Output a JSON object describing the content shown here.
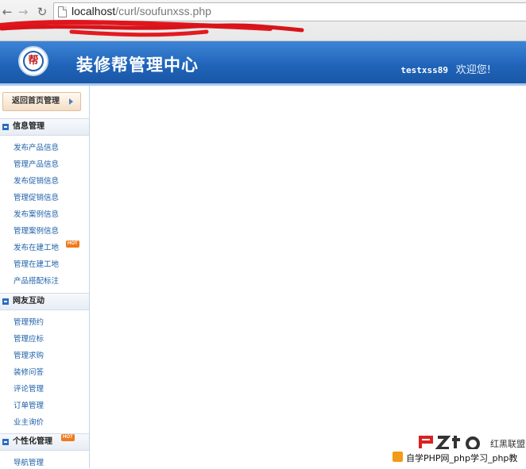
{
  "browser": {
    "url_host": "localhost",
    "url_path": "/curl/soufunxss.php"
  },
  "header": {
    "logo_text": "帮",
    "title": "装修帮管理中心",
    "username": "testxss89",
    "welcome": "欢迎您!"
  },
  "sidebar": {
    "home_button": "返回首页管理",
    "hot_badge": "HOT",
    "sections": [
      {
        "title": "信息管理",
        "items": [
          "发布产品信息",
          "管理产品信息",
          "发布促销信息",
          "管理促销信息",
          "发布案例信息",
          "管理案例信息",
          "发布在建工地",
          "管理在建工地",
          "产品搭配标注"
        ]
      },
      {
        "title": "网友互动",
        "items": [
          "管理预约",
          "管理应标",
          "管理求购",
          "装修问答",
          "评论管理",
          "订单管理",
          "业主询价"
        ]
      },
      {
        "title": "个性化管理",
        "items": [
          "导航管理"
        ]
      }
    ]
  },
  "watermark": {
    "brand_top": "红黑联盟",
    "bar_text": "自学PHP网_php学习_php教"
  },
  "colors": {
    "header_blue": "#1f63b8",
    "link_blue": "#1c5fa8",
    "hot_orange": "#f07a1c"
  }
}
